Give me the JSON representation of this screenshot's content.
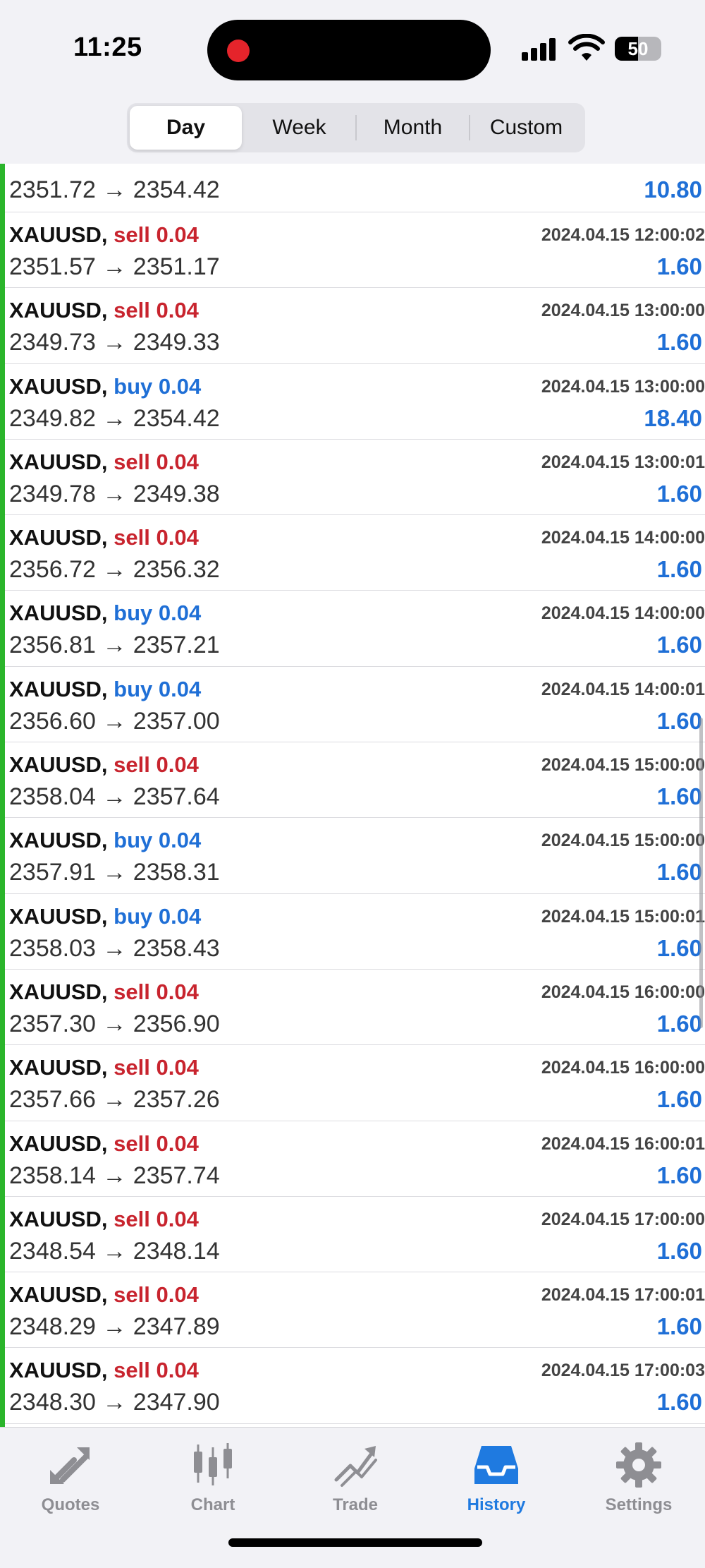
{
  "status_bar": {
    "time": "11:25",
    "battery": "50",
    "battery_level": 0.5
  },
  "segment": {
    "tabs": [
      {
        "label": "Day",
        "active": true
      },
      {
        "label": "Week",
        "active": false
      },
      {
        "label": "Month",
        "active": false
      },
      {
        "label": "Custom",
        "active": false
      }
    ]
  },
  "colors": {
    "sell": "#c8242e",
    "buy": "#1f6fd6",
    "profit": "#1f6fd6",
    "accent_bar": "#2bb52b",
    "active_tab": "#1f7ae0"
  },
  "trades": [
    {
      "symbol": "",
      "side": "",
      "volume": "",
      "time": "",
      "prices": "2351.72 → 2354.42",
      "profit": "10.80"
    },
    {
      "symbol": "XAUUSD,",
      "side": "sell",
      "volume": "0.04",
      "time": "2024.04.15 12:00:02",
      "prices": "2351.57 → 2351.17",
      "profit": "1.60"
    },
    {
      "symbol": "XAUUSD,",
      "side": "sell",
      "volume": "0.04",
      "time": "2024.04.15 13:00:00",
      "prices": "2349.73 → 2349.33",
      "profit": "1.60"
    },
    {
      "symbol": "XAUUSD,",
      "side": "buy",
      "volume": "0.04",
      "time": "2024.04.15 13:00:00",
      "prices": "2349.82 → 2354.42",
      "profit": "18.40"
    },
    {
      "symbol": "XAUUSD,",
      "side": "sell",
      "volume": "0.04",
      "time": "2024.04.15 13:00:01",
      "prices": "2349.78 → 2349.38",
      "profit": "1.60"
    },
    {
      "symbol": "XAUUSD,",
      "side": "sell",
      "volume": "0.04",
      "time": "2024.04.15 14:00:00",
      "prices": "2356.72 → 2356.32",
      "profit": "1.60"
    },
    {
      "symbol": "XAUUSD,",
      "side": "buy",
      "volume": "0.04",
      "time": "2024.04.15 14:00:00",
      "prices": "2356.81 → 2357.21",
      "profit": "1.60"
    },
    {
      "symbol": "XAUUSD,",
      "side": "buy",
      "volume": "0.04",
      "time": "2024.04.15 14:00:01",
      "prices": "2356.60 → 2357.00",
      "profit": "1.60"
    },
    {
      "symbol": "XAUUSD,",
      "side": "sell",
      "volume": "0.04",
      "time": "2024.04.15 15:00:00",
      "prices": "2358.04 → 2357.64",
      "profit": "1.60"
    },
    {
      "symbol": "XAUUSD,",
      "side": "buy",
      "volume": "0.04",
      "time": "2024.04.15 15:00:00",
      "prices": "2357.91 → 2358.31",
      "profit": "1.60"
    },
    {
      "symbol": "XAUUSD,",
      "side": "buy",
      "volume": "0.04",
      "time": "2024.04.15 15:00:01",
      "prices": "2358.03 → 2358.43",
      "profit": "1.60"
    },
    {
      "symbol": "XAUUSD,",
      "side": "sell",
      "volume": "0.04",
      "time": "2024.04.15 16:00:00",
      "prices": "2357.30 → 2356.90",
      "profit": "1.60"
    },
    {
      "symbol": "XAUUSD,",
      "side": "sell",
      "volume": "0.04",
      "time": "2024.04.15 16:00:00",
      "prices": "2357.66 → 2357.26",
      "profit": "1.60"
    },
    {
      "symbol": "XAUUSD,",
      "side": "sell",
      "volume": "0.04",
      "time": "2024.04.15 16:00:01",
      "prices": "2358.14 → 2357.74",
      "profit": "1.60"
    },
    {
      "symbol": "XAUUSD,",
      "side": "sell",
      "volume": "0.04",
      "time": "2024.04.15 17:00:00",
      "prices": "2348.54 → 2348.14",
      "profit": "1.60"
    },
    {
      "symbol": "XAUUSD,",
      "side": "sell",
      "volume": "0.04",
      "time": "2024.04.15 17:00:01",
      "prices": "2348.29 → 2347.89",
      "profit": "1.60"
    },
    {
      "symbol": "XAUUSD,",
      "side": "sell",
      "volume": "0.04",
      "time": "2024.04.15 17:00:03",
      "prices": "2348.30 → 2347.90",
      "profit": "1.60"
    }
  ],
  "tabbar": {
    "items": [
      {
        "label": "Quotes",
        "icon": "quotes-icon",
        "active": false
      },
      {
        "label": "Chart",
        "icon": "chart-icon",
        "active": false
      },
      {
        "label": "Trade",
        "icon": "trade-icon",
        "active": false
      },
      {
        "label": "History",
        "icon": "history-icon",
        "active": true
      },
      {
        "label": "Settings",
        "icon": "gear-icon",
        "active": false
      }
    ]
  }
}
